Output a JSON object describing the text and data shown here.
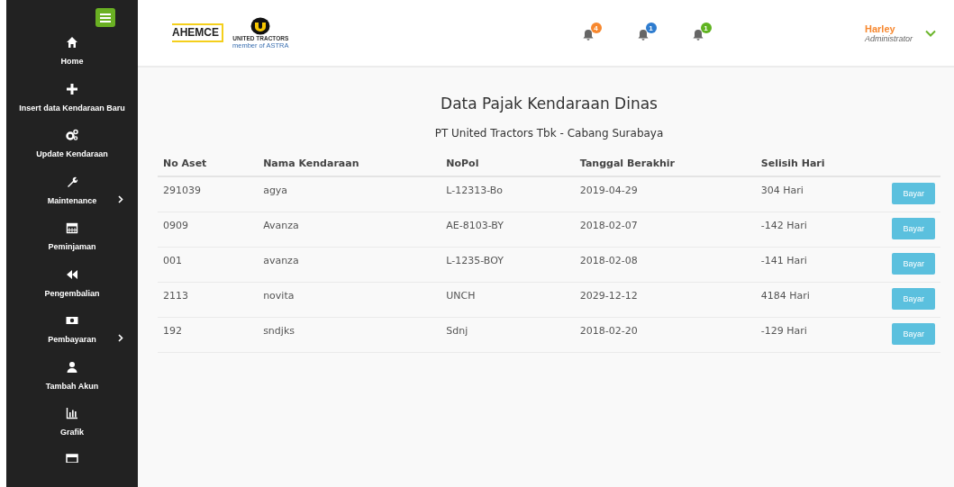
{
  "sidebar": {
    "items": [
      {
        "label": "Home",
        "kind": "home",
        "submenu": false
      },
      {
        "label": "Insert data Kendaraan Baru",
        "kind": "plus",
        "submenu": false
      },
      {
        "label": "Update Kendaraan",
        "kind": "gears",
        "submenu": false
      },
      {
        "label": "Maintenance",
        "kind": "wrench",
        "submenu": true
      },
      {
        "label": "Peminjaman",
        "kind": "calendar",
        "submenu": false
      },
      {
        "label": "Pengembalian",
        "kind": "backward",
        "submenu": false
      },
      {
        "label": "Pembayaran",
        "kind": "money",
        "submenu": true
      },
      {
        "label": "Tambah Akun",
        "kind": "user",
        "submenu": false
      },
      {
        "label": "Grafik",
        "kind": "chart",
        "submenu": false
      }
    ]
  },
  "header": {
    "logos": {
      "ahemce": "AHEMCE",
      "united_tractors": "UNITED TRACTORS",
      "tagline": "member of ASTRA"
    },
    "notifications": [
      {
        "count": "4",
        "color": "#f7882f"
      },
      {
        "count": "1",
        "color": "#2e7ccf"
      },
      {
        "count": "1",
        "color": "#5fb320"
      }
    ],
    "user": {
      "name": "Harley",
      "role": "Administrator"
    }
  },
  "page": {
    "title": "Data Pajak Kendaraan Dinas",
    "subtitle": "PT United Tractors Tbk - Cabang Surabaya"
  },
  "table": {
    "columns": [
      "No Aset",
      "Nama Kendaraan",
      "NoPol",
      "Tanggal Berakhir",
      "Selisih Hari"
    ],
    "rows": [
      {
        "cells": [
          "291039",
          "agya",
          "L-12313-Bo",
          "2019-04-29",
          "304 Hari"
        ],
        "action": "Bayar"
      },
      {
        "cells": [
          "0909",
          "Avanza",
          "AE-8103-BY",
          "2018-02-07",
          "-142 Hari"
        ],
        "action": "Bayar"
      },
      {
        "cells": [
          "001",
          "avanza",
          "L-1235-BOY",
          "2018-02-08",
          "-141 Hari"
        ],
        "action": "Bayar"
      },
      {
        "cells": [
          "2113",
          "novita",
          "UNCH",
          "2029-12-12",
          "4184 Hari"
        ],
        "action": "Bayar"
      },
      {
        "cells": [
          "192",
          "sndjks",
          "Sdnj",
          "2018-02-20",
          "-129 Hari"
        ],
        "action": "Bayar"
      }
    ]
  }
}
